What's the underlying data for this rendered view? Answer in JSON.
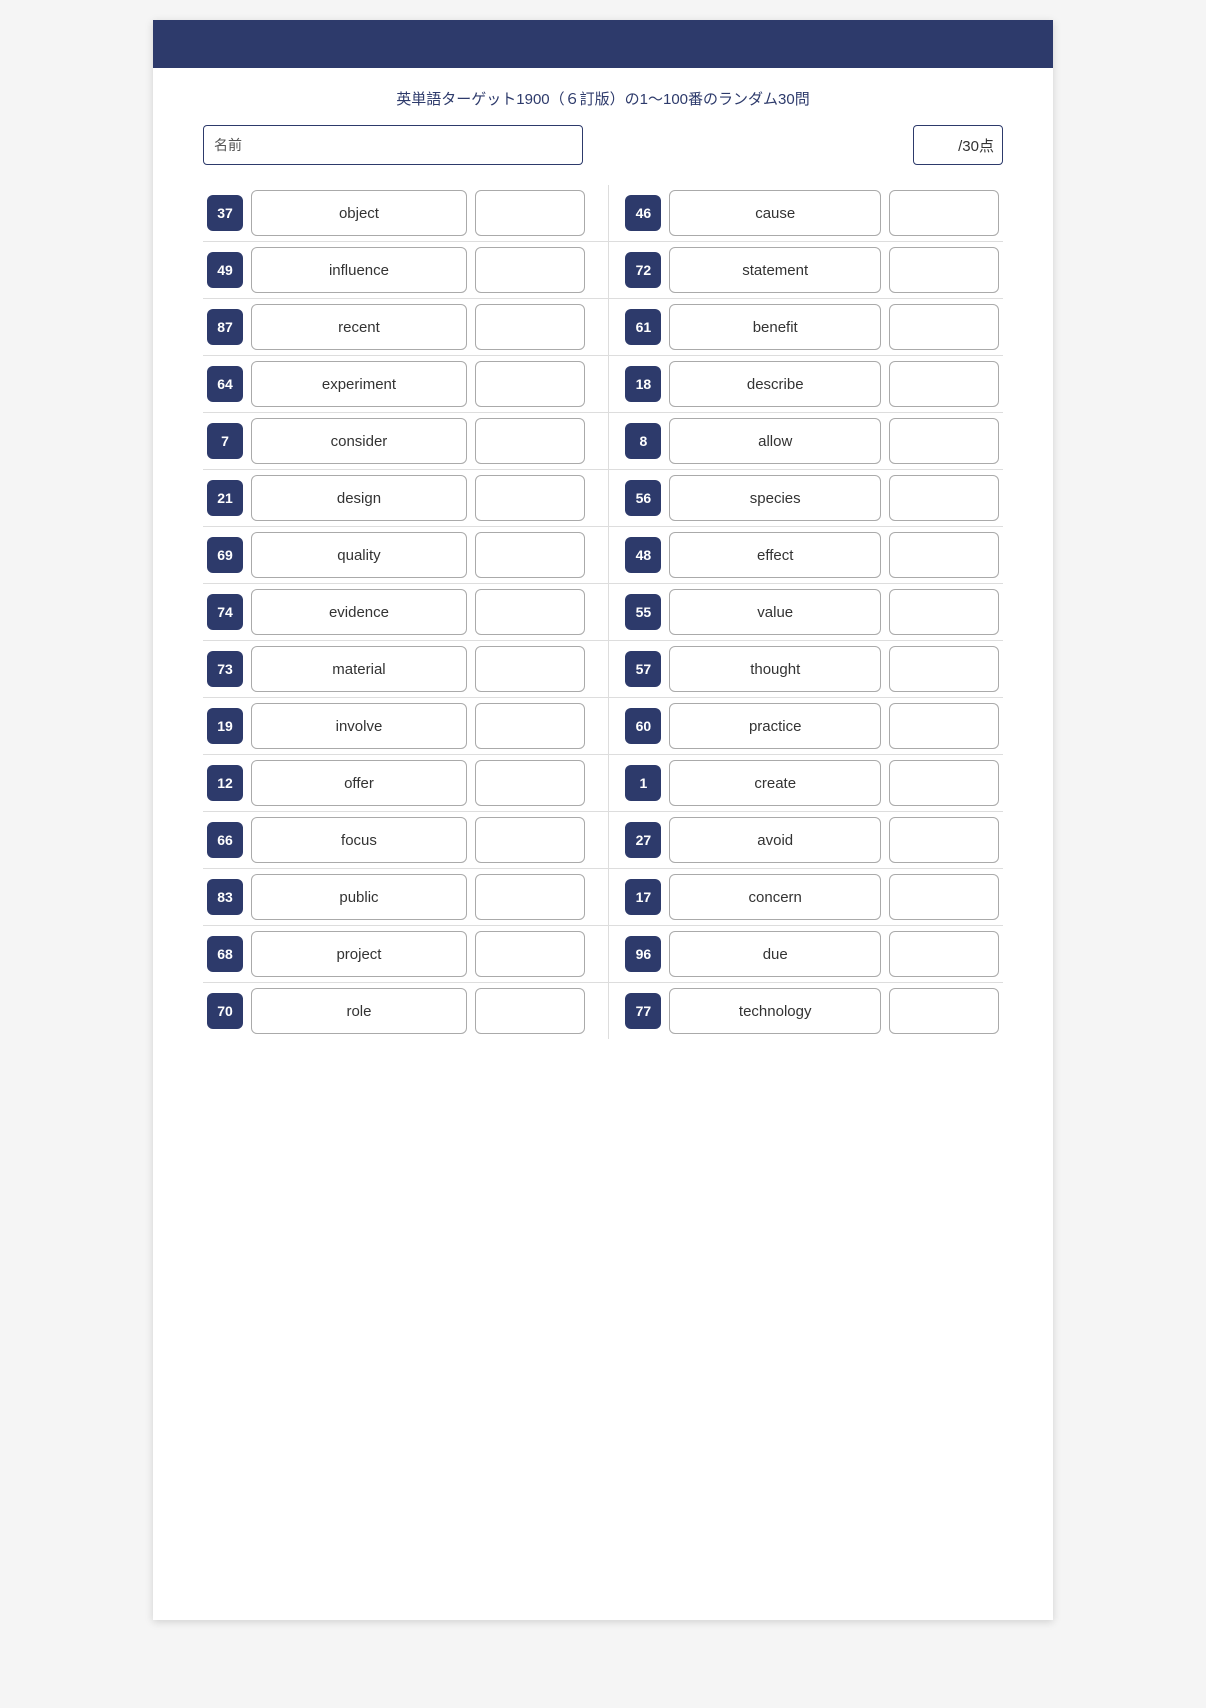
{
  "header": {
    "bg_color": "#2d3a6b",
    "subtitle": "英単語ターゲット1900（６訂版）の1〜100番のランダム30問"
  },
  "name_field": {
    "label": "名前",
    "placeholder": ""
  },
  "score_field": {
    "label": "/30点"
  },
  "left_items": [
    {
      "num": "37",
      "word": "object"
    },
    {
      "num": "49",
      "word": "influence"
    },
    {
      "num": "87",
      "word": "recent"
    },
    {
      "num": "64",
      "word": "experiment"
    },
    {
      "num": "7",
      "word": "consider"
    },
    {
      "num": "21",
      "word": "design"
    },
    {
      "num": "69",
      "word": "quality"
    },
    {
      "num": "74",
      "word": "evidence"
    },
    {
      "num": "73",
      "word": "material"
    },
    {
      "num": "19",
      "word": "involve"
    },
    {
      "num": "12",
      "word": "offer"
    },
    {
      "num": "66",
      "word": "focus"
    },
    {
      "num": "83",
      "word": "public"
    },
    {
      "num": "68",
      "word": "project"
    },
    {
      "num": "70",
      "word": "role"
    }
  ],
  "right_items": [
    {
      "num": "46",
      "word": "cause"
    },
    {
      "num": "72",
      "word": "statement"
    },
    {
      "num": "61",
      "word": "benefit"
    },
    {
      "num": "18",
      "word": "describe"
    },
    {
      "num": "8",
      "word": "allow"
    },
    {
      "num": "56",
      "word": "species"
    },
    {
      "num": "48",
      "word": "effect"
    },
    {
      "num": "55",
      "word": "value"
    },
    {
      "num": "57",
      "word": "thought"
    },
    {
      "num": "60",
      "word": "practice"
    },
    {
      "num": "1",
      "word": "create"
    },
    {
      "num": "27",
      "word": "avoid"
    },
    {
      "num": "17",
      "word": "concern"
    },
    {
      "num": "96",
      "word": "due"
    },
    {
      "num": "77",
      "word": "technology"
    }
  ]
}
